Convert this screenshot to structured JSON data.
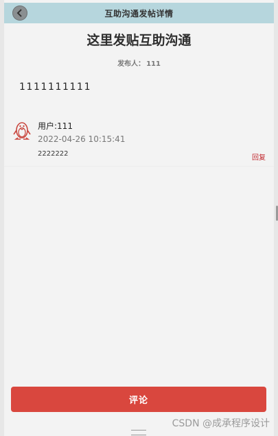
{
  "header": {
    "title": "互助沟通发帖详情"
  },
  "post": {
    "title": "这里发贴互助沟通",
    "publisher_label": "发布人：",
    "publisher_name": "111",
    "content": "1111111111"
  },
  "replies": [
    {
      "user": "用户:111",
      "time": "2022-04-26 10:15:41",
      "text": "2222222",
      "reply_label": "回复"
    }
  ],
  "footer": {
    "comment_label": "评论"
  },
  "watermark": "CSDN @成承程序设计",
  "colors": {
    "header_bg": "#b6d6dd",
    "accent_red": "#d9473e",
    "reply_red": "#c0272d"
  },
  "icons": {
    "back": "chevron-left-icon",
    "avatar": "qq-penguin-icon"
  }
}
